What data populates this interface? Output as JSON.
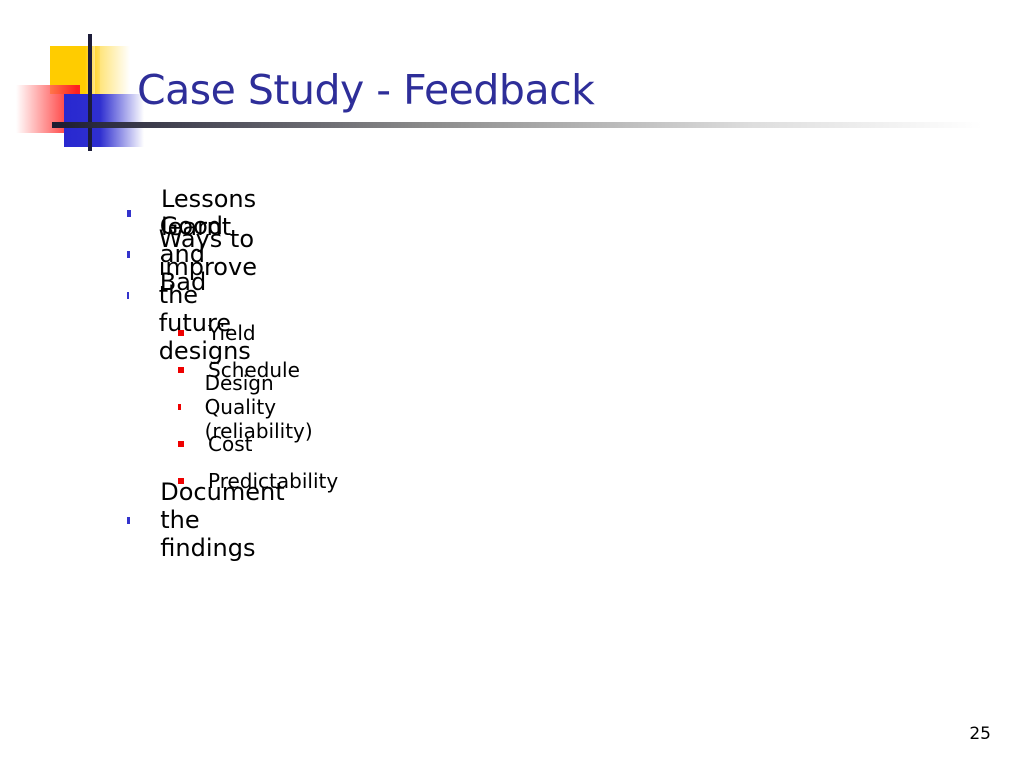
{
  "slide": {
    "title": "Case Study - Feedback",
    "page_number": "25",
    "bullets": [
      {
        "level": 1,
        "text": "Lessons learnt"
      },
      {
        "level": 1,
        "text": "Good and Bad"
      },
      {
        "level": 1,
        "text": "Ways to improve the future designs"
      },
      {
        "level": 2,
        "text": "Yield"
      },
      {
        "level": 2,
        "text": "Schedule"
      },
      {
        "level": 2,
        "text": "Design Quality (reliability)"
      },
      {
        "level": 2,
        "text": "Cost"
      },
      {
        "level": 2,
        "text": "Predictability"
      },
      {
        "level": 1,
        "text": "Document the findings"
      }
    ],
    "colors": {
      "title": "#2e2e99",
      "bullet_level1": "#3333cc",
      "bullet_level2": "#ee0000"
    }
  }
}
